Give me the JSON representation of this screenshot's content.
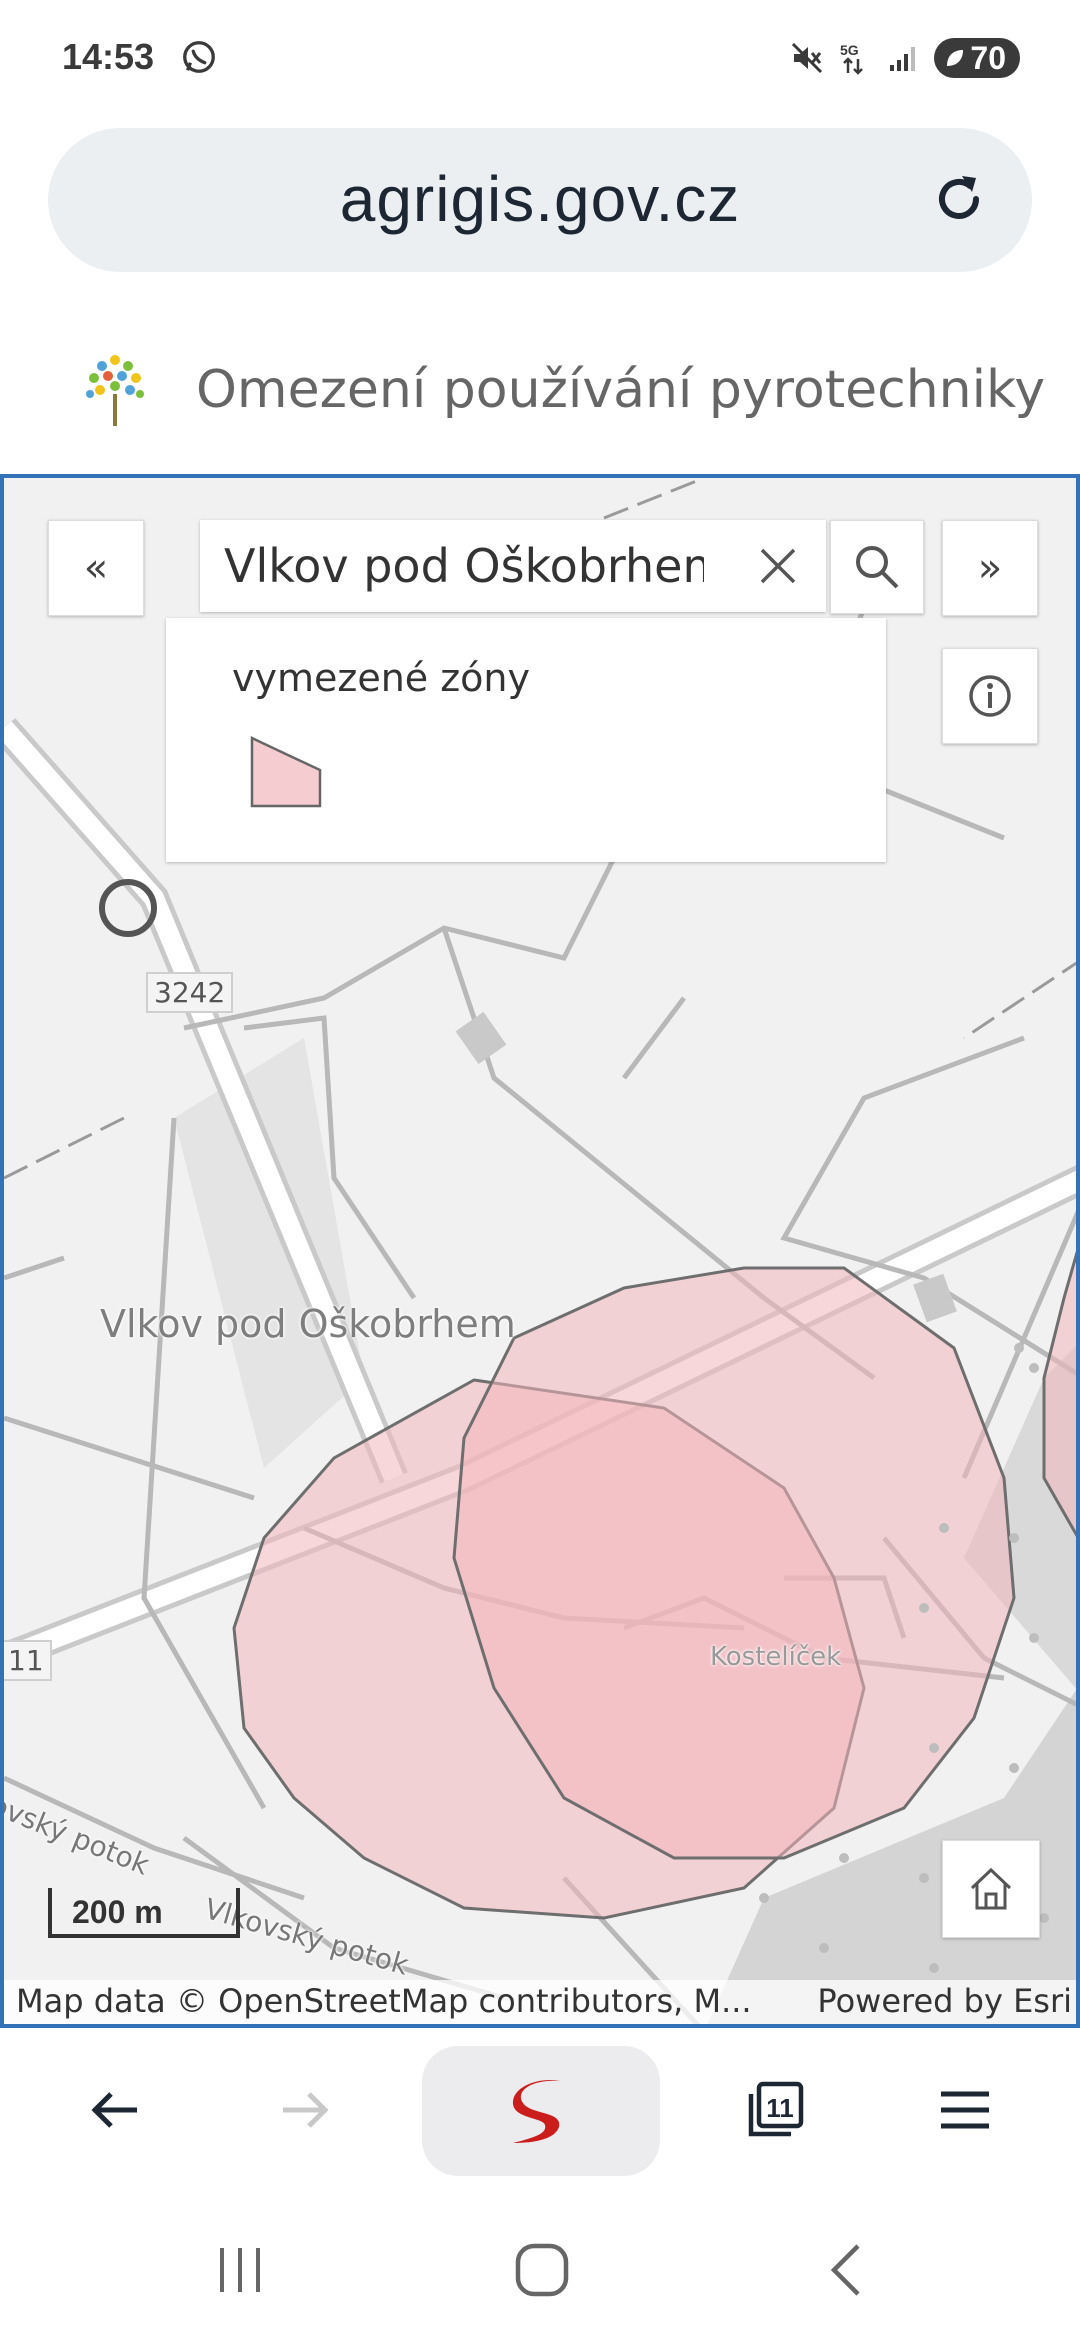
{
  "status_bar": {
    "time": "14:53",
    "notification_icon": "whatsapp-icon",
    "network": "5G",
    "battery": "70",
    "icons": [
      "mute-icon",
      "5g-icon",
      "signal-icon",
      "battery-icon"
    ]
  },
  "browser": {
    "url": "agrigis.gov.cz",
    "reload_icon": "reload-icon"
  },
  "site": {
    "title": "Omezení používání pyrotechniky",
    "logo": "tree-logo"
  },
  "map": {
    "search": {
      "value": "Vlkov pod Oškobrhem",
      "clear_icon": "close-icon",
      "search_icon": "search-icon"
    },
    "collapse_label": "«",
    "expand_label": "»",
    "legend": {
      "title": "vymezené zóny",
      "swatch_color": "#f5cdd0"
    },
    "labels": {
      "place_main": "Vlkov pod Oškobrhem",
      "place_secondary": "Kostelíček",
      "stream_1": "ovský potok",
      "stream_2": "Vlkovský potok",
      "road_3242": "3242",
      "road_11": "11"
    },
    "scale_label": "200 m",
    "attribution_left": "Map data © OpenStreetMap contributors, M...",
    "attribution_right": "Powered by Esri",
    "zone_color": "#f2b6bc",
    "border_color": "#3372b8"
  },
  "browser_bar": {
    "tab_count": "11",
    "icons": [
      "back-arrow-icon",
      "forward-arrow-icon",
      "seznam-logo",
      "tabs-icon",
      "menu-icon"
    ]
  },
  "android_nav": {
    "icons": [
      "recents-icon",
      "home-icon",
      "back-icon"
    ]
  }
}
